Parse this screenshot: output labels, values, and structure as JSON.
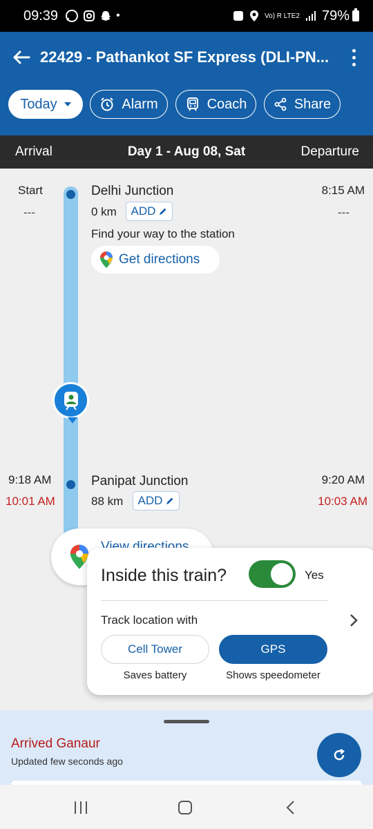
{
  "status_bar": {
    "time": "09:39",
    "network": "Vo) R LTE2",
    "battery": "79%"
  },
  "header": {
    "title": "22429 - Pathankot SF Express (DLI-PN..."
  },
  "chips": {
    "today": "Today",
    "alarm": "Alarm",
    "coach": "Coach",
    "share": "Share"
  },
  "day_bar": {
    "arrival": "Arrival",
    "day": "Day 1 - Aug 08, Sat",
    "departure": "Departure"
  },
  "stops": [
    {
      "arrival_sched": "Start",
      "arrival_actual": "---",
      "name": "Delhi Junction",
      "distance": "0 km",
      "add_label": "ADD",
      "departure_sched": "8:15 AM",
      "departure_actual": "---",
      "hint": "Find your way to the station",
      "directions_label": "Get directions"
    },
    {
      "arrival_sched": "9:18 AM",
      "arrival_actual": "10:01 AM",
      "name": "Panipat Junction",
      "distance": "88 km",
      "add_label": "ADD",
      "departure_sched": "9:20 AM",
      "departure_actual": "10:03 AM"
    }
  ],
  "view_directions": "View directions",
  "inside_train": {
    "question": "Inside this train?",
    "toggle_state": "Yes",
    "track_label": "Track location with",
    "options": [
      {
        "label": "Cell Tower",
        "sub": "Saves battery",
        "selected": false
      },
      {
        "label": "GPS",
        "sub": "Shows speedometer",
        "selected": true
      }
    ]
  },
  "bottom_sheet": {
    "status": "Arrived Ganaur",
    "updated": "Updated few seconds ago"
  },
  "colors": {
    "brand": "#1560a8",
    "late": "#c62020",
    "toggle_on": "#2a8a3a",
    "track": "#8ec9ee"
  }
}
